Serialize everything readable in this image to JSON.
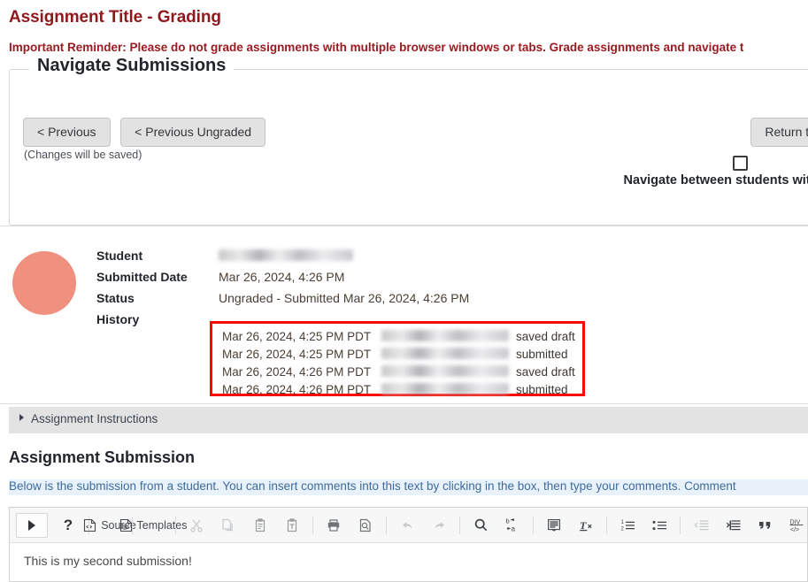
{
  "header": {
    "title": "Assignment Title - Grading",
    "reminder": "Important Reminder: Please do not grade assignments with multiple browser windows or tabs. Grade assignments and navigate t",
    "title_color": "#90181c",
    "reminder_color": "#9c1b20"
  },
  "navigate": {
    "legend": "Navigate Submissions",
    "previous_label": "< Previous",
    "previous_ungraded_label": "< Previous Ungraded",
    "changes_note": "(Changes will be saved)",
    "return_label": "Return to List",
    "checkbox_label": "Navigate between students with s\nonly",
    "checkbox_checked": false
  },
  "student": {
    "avatar_color": "#f0907f",
    "rows": [
      {
        "label": "Student",
        "value": "",
        "redacted": true,
        "redact_width": 152
      },
      {
        "label": "Submitted Date",
        "value": "Mar 26, 2024, 4:26 PM",
        "redacted": false
      },
      {
        "label": "Status",
        "value": "Ungraded - Submitted Mar 26, 2024, 4:26 PM",
        "redacted": false
      },
      {
        "label": "History",
        "value": "",
        "redacted": false
      }
    ]
  },
  "history": {
    "border_color": "#f90a04",
    "entries": [
      {
        "date": "Mar 26, 2024, 4:25 PM PDT",
        "user": "",
        "action": "saved draft"
      },
      {
        "date": "Mar 26, 2024, 4:25 PM PDT",
        "user": "",
        "action": "submitted"
      },
      {
        "date": "Mar 26, 2024, 4:26 PM PDT",
        "user": "",
        "action": "saved draft"
      },
      {
        "date": "Mar 26, 2024, 4:26 PM PDT",
        "user": "",
        "action": "submitted"
      }
    ]
  },
  "instructions_accordion": {
    "label": "Assignment Instructions",
    "expanded": false
  },
  "submission": {
    "section_title": "Assignment Submission",
    "help_text": "Below is the submission from a student. You can insert comments into this text by clicking in the box, then type your comments. Comment",
    "help_text_color": "#3d6b9e",
    "body_text": "This is my second submission!"
  },
  "toolbar": {
    "groups": [
      {
        "items": [
          {
            "name": "toolbar-expand-icon",
            "icon": "triangle-right",
            "label": "",
            "boxed": true,
            "disabled": false
          },
          {
            "name": "help-icon",
            "icon": "question-mark",
            "label": "",
            "boxed": false,
            "disabled": false
          }
        ]
      },
      {
        "items": [
          {
            "name": "source-button",
            "icon": "code-document-icon",
            "label": "Source",
            "boxed": false,
            "disabled": false
          }
        ]
      },
      {
        "items": [
          {
            "name": "templates-button",
            "icon": "document-icon",
            "label": "Templates",
            "boxed": false,
            "disabled": false
          }
        ]
      },
      {
        "items": [
          {
            "name": "cut-button",
            "icon": "scissors-icon",
            "label": "",
            "boxed": false,
            "disabled": true
          },
          {
            "name": "copy-button",
            "icon": "copy-icon",
            "label": "",
            "boxed": false,
            "disabled": true
          },
          {
            "name": "paste-button",
            "icon": "clipboard-icon",
            "label": "",
            "boxed": false,
            "disabled": false
          },
          {
            "name": "paste-as-text-button",
            "icon": "clipboard-text-icon",
            "label": "",
            "boxed": false,
            "disabled": false
          }
        ]
      },
      {
        "items": [
          {
            "name": "print-button",
            "icon": "printer-icon",
            "label": "",
            "boxed": false,
            "disabled": false
          },
          {
            "name": "preview-button",
            "icon": "preview-magnifier-icon",
            "label": "",
            "boxed": false,
            "disabled": false
          }
        ]
      },
      {
        "items": [
          {
            "name": "undo-button",
            "icon": "undo-arrow-icon",
            "label": "",
            "boxed": false,
            "disabled": true
          },
          {
            "name": "redo-button",
            "icon": "redo-arrow-icon",
            "label": "",
            "boxed": false,
            "disabled": true
          }
        ]
      },
      {
        "items": [
          {
            "name": "find-button",
            "icon": "magnifier-icon",
            "label": "",
            "boxed": false,
            "disabled": false
          },
          {
            "name": "replace-button",
            "icon": "replace-icon",
            "label": "",
            "boxed": false,
            "disabled": false
          }
        ]
      },
      {
        "items": [
          {
            "name": "select-all-button",
            "icon": "select-all-icon",
            "label": "",
            "boxed": false,
            "disabled": false
          },
          {
            "name": "remove-format-button",
            "icon": "remove-format-icon",
            "label": "",
            "boxed": false,
            "disabled": false
          }
        ]
      },
      {
        "items": [
          {
            "name": "numbered-list-button",
            "icon": "numbered-list-icon",
            "label": "",
            "boxed": false,
            "disabled": false
          },
          {
            "name": "bulleted-list-button",
            "icon": "bulleted-list-icon",
            "label": "",
            "boxed": false,
            "disabled": false
          }
        ]
      },
      {
        "items": [
          {
            "name": "outdent-button",
            "icon": "outdent-icon",
            "label": "",
            "boxed": false,
            "disabled": true
          },
          {
            "name": "indent-button",
            "icon": "indent-icon",
            "label": "",
            "boxed": false,
            "disabled": false
          },
          {
            "name": "blockquote-button",
            "icon": "quote-icon",
            "label": "",
            "boxed": false,
            "disabled": false
          },
          {
            "name": "div-container-button",
            "icon": "div-container-icon",
            "label": "",
            "boxed": false,
            "disabled": false
          }
        ]
      }
    ]
  }
}
